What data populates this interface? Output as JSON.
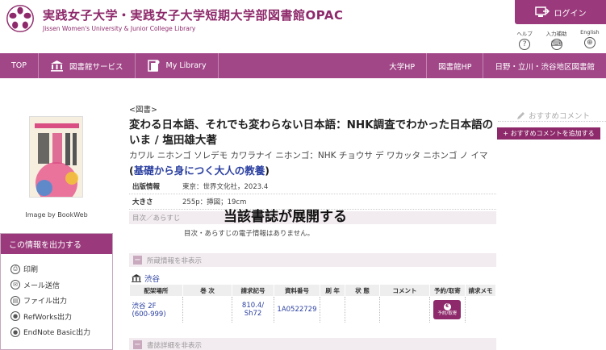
{
  "header": {
    "title": "実践女子大学・実践女子大学短期大学部図書館",
    "title_opac": "OPAC",
    "subtitle": "Jissen Women's University & Junior College Library",
    "login_label": "ログイン",
    "utilities": [
      {
        "label": "ヘルプ",
        "glyph": "?",
        "icon": "help-icon"
      },
      {
        "label": "入力補助",
        "glyph": "⌨",
        "icon": "input-assist-icon"
      },
      {
        "label": "English",
        "glyph": "⊕",
        "icon": "globe-icon"
      }
    ]
  },
  "nav": {
    "top": "TOP",
    "services": "図書館サービス",
    "my_library": "My Library",
    "univ_hp": "大学HP",
    "library_hp": "図書館HP",
    "area_library": "日野・立川・渋谷地区図書館"
  },
  "sidebar": {
    "cover_caption": "Image by BookWeb",
    "export_title": "この情報を出力する",
    "export_items": [
      {
        "label": "印刷",
        "icon": "print-icon",
        "glyph": "⎙"
      },
      {
        "label": "メール送信",
        "icon": "mail-icon",
        "glyph": "✉"
      },
      {
        "label": "ファイル出力",
        "icon": "file-icon",
        "glyph": "▤"
      },
      {
        "label": "RefWorks出力",
        "icon": "refworks-icon",
        "glyph": "●"
      },
      {
        "label": "EndNote Basic出力",
        "icon": "endnote-icon",
        "glyph": "●"
      }
    ]
  },
  "record": {
    "type": "<図書>",
    "title": "変わる日本語、それでも変わらない日本語：NHK調査でわかった日本語のいま / 塩田雄大著",
    "kana": "カワル ニホンゴ ソレデモ カワラナイ ニホンゴ：NHK チョウサ デ ワカッタ ニホンゴ ノ イマ",
    "series_open": "(",
    "series": "基礎から身につく大人の教養",
    "series_close": ")",
    "info": [
      {
        "key": "出版情報",
        "value": "東京：世界文化社，2023.4"
      },
      {
        "key": "大きさ",
        "value": "255p：挿図；19cm"
      }
    ],
    "toc_label": "目次／あらすじ",
    "toc_body": "目次・あらすじの電子情報はありません。",
    "overlay_text": "当該書誌が展開する",
    "holdings_toggle": "所蔵情報を非表示",
    "details_toggle": "書誌詳細を非表示"
  },
  "holdings": {
    "library": "渋谷",
    "columns": [
      "配架場所",
      "巻 次",
      "請求記号",
      "資料番号",
      "刷 年",
      "状 態",
      "コメント",
      "予約/取寄",
      "請求メモ"
    ],
    "rows": [
      {
        "location_1": "渋谷 2F",
        "location_2": "(600-999)",
        "volume": "",
        "call_no_1": "810.4/",
        "call_no_2": "Sh72",
        "item_no": "1A0522729",
        "year": "",
        "status": "",
        "comment": "",
        "reserve_label": "予約/取寄",
        "memo": ""
      }
    ]
  },
  "right": {
    "recommend_title": "おすすめコメント",
    "recommend_add": "+ おすすめコメントを追加する"
  },
  "colors": {
    "brand": "#9a3a7c",
    "nav": "#a14788",
    "link": "#2a3fa0"
  }
}
